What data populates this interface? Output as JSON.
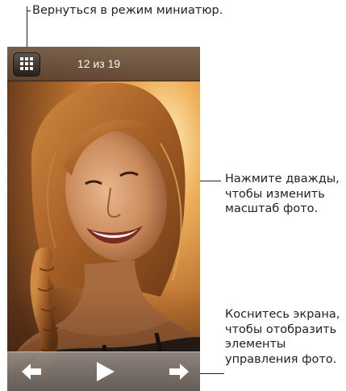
{
  "callouts": {
    "thumbnails": "Вернуться в режим миниатюр.",
    "zoom": [
      "Нажмите дважды,",
      "чтобы изменить",
      "масштаб фото."
    ],
    "controls": [
      "Коснитесь экрана,",
      "чтобы отобразить",
      "элементы",
      "управления фото."
    ]
  },
  "viewer": {
    "counter": "12 из 19",
    "thumbnails_icon": "grid-icon",
    "prev_icon": "arrow-left-icon",
    "play_icon": "play-icon",
    "next_icon": "arrow-right-icon"
  }
}
